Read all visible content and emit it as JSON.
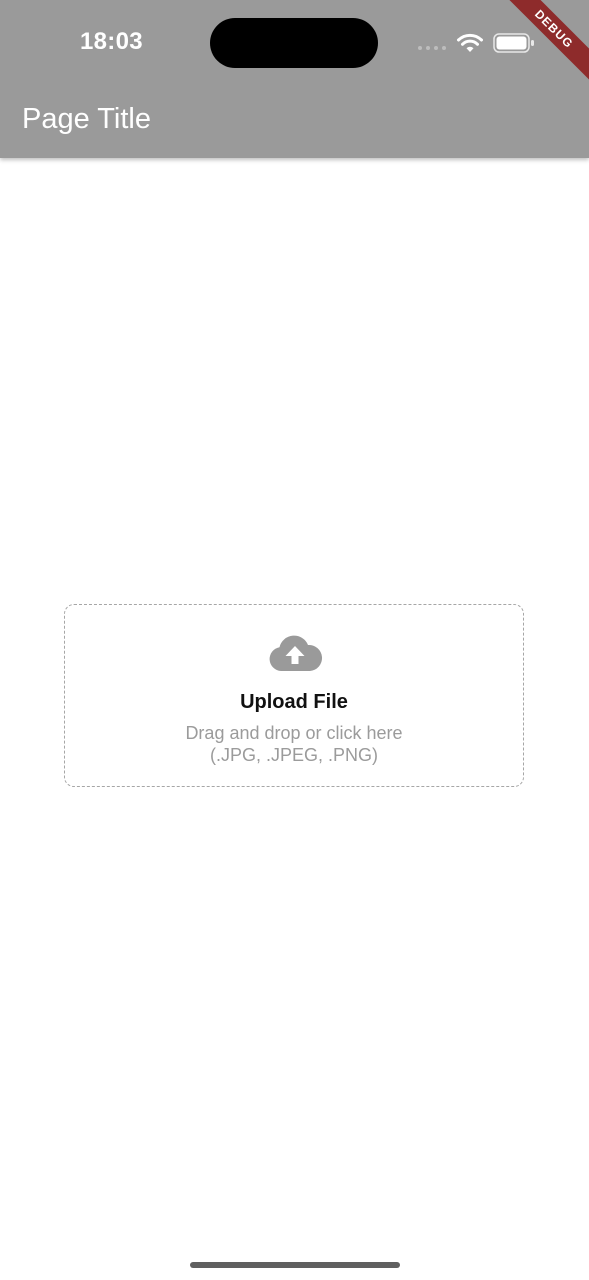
{
  "status_bar": {
    "time": "18:03"
  },
  "debug_banner": {
    "label": "DEBUG",
    "color": "#8e2b2b"
  },
  "app_bar": {
    "title": "Page Title",
    "background": "#9a9a9a"
  },
  "upload": {
    "icon": "cloud-upload-icon",
    "title": "Upload File",
    "hint": "Drag and drop or click here",
    "file_types": "(.JPG, .JPEG, .PNG)"
  }
}
